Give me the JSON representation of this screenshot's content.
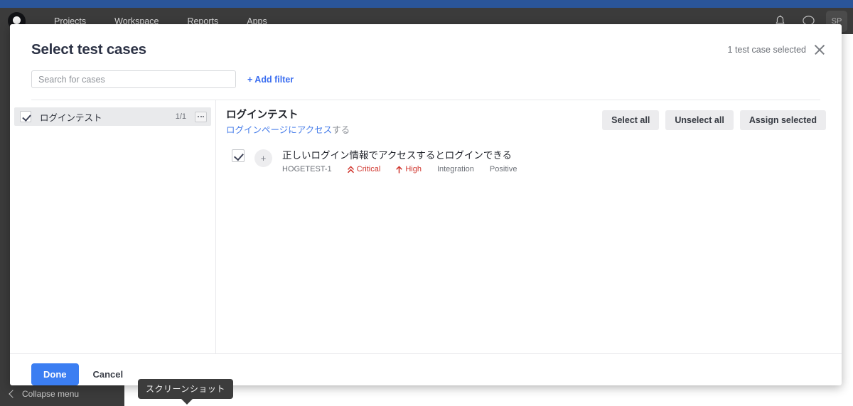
{
  "topnav": {
    "brand_icon": "app-logo-icon",
    "links": [
      {
        "label": "Projects"
      },
      {
        "label": "Workspace"
      },
      {
        "label": "Reports"
      },
      {
        "label": "Apps"
      }
    ],
    "notifications_icon": "bell-icon",
    "messages_icon": "chat-bubble-icon",
    "avatar_initials": "SP"
  },
  "app_background": {
    "collapse_menu_label": "Collapse menu",
    "collapse_icon": "chevron-left-icon"
  },
  "modal": {
    "title": "Select test cases",
    "selected_count_label": "1 test case selected",
    "close_icon": "close-icon",
    "search": {
      "placeholder": "Search for cases",
      "value": ""
    },
    "add_filter_label": "+ Add filter",
    "tree": {
      "items": [
        {
          "label": "ログインテスト",
          "count": "1/1",
          "checked": true,
          "more_icon": "ellipsis-icon"
        }
      ]
    },
    "cases_panel": {
      "suite_title": "ログインテスト",
      "suite_sub_link": "ログインページにアクセス",
      "suite_sub_muted": "する",
      "actions": [
        {
          "label": "Select all",
          "name": "select-all-button"
        },
        {
          "label": "Unselect all",
          "name": "unselect-all-button"
        },
        {
          "label": "Assign selected",
          "name": "assign-selected-button"
        }
      ],
      "cases": [
        {
          "checked": true,
          "avatar_glyph": "+",
          "title": "正しいログイン情報でアクセスするとログインできる",
          "id": "HOGETEST-1",
          "severity": "Critical",
          "severity_icon": "double-chevron-up-icon",
          "priority": "High",
          "priority_icon": "arrow-up-icon",
          "layer": "Integration",
          "type": "Positive"
        }
      ]
    },
    "footer": {
      "done_label": "Done",
      "cancel_label": "Cancel"
    }
  },
  "tooltip": {
    "text": "スクリーンショット"
  },
  "colors": {
    "accent_blue": "#3b7ef2",
    "link_blue": "#4a7fea",
    "danger_red": "#d0342c",
    "nav_dark": "#3b3b3b",
    "browser_bar": "#2a5599",
    "tooltip_bg": "#3c3c3c"
  }
}
